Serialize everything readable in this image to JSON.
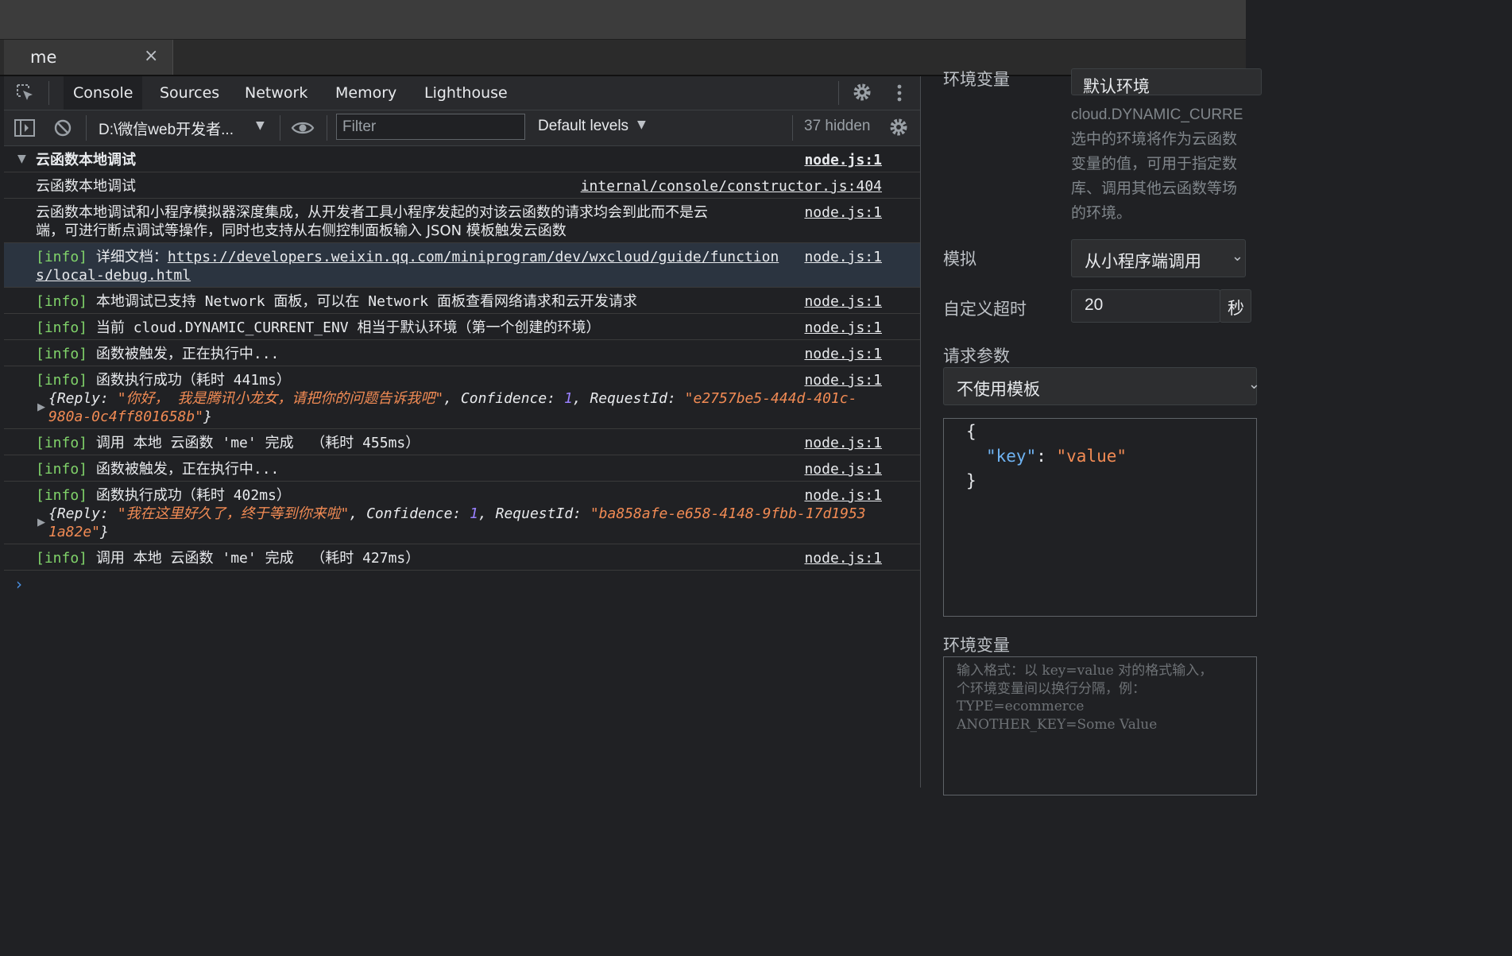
{
  "tab": {
    "title": "me",
    "close": "×"
  },
  "devtools": {
    "tabs": [
      "Console",
      "Sources",
      "Network",
      "Memory",
      "Lighthouse"
    ],
    "context": "D:\\微信web开发者...",
    "filter_placeholder": "Filter",
    "levels": "Default levels",
    "hidden_count": "37 hidden"
  },
  "console": {
    "group_title": "云函数本地调试",
    "group_src": "node.js:1",
    "rows": [
      {
        "text": "云函数本地调试",
        "src": "internal/console/constructor.js:404"
      },
      {
        "line1": "云函数本地调试和小程序模拟器深度集成，从开发者工具小程序发起的对该云函数的请求均会到此而不是云",
        "line2": "端，可进行断点调试等操作，同时也支持从右侧控制面板输入 JSON 模板触发云函数",
        "src": "node.js:1"
      },
      {
        "tag": "[info]",
        "prefix": "详细文档：",
        "link1": "https://developers.weixin.qq.com/miniprogram/dev/wxcloud/guide/function",
        "link2": "s/local-debug.html",
        "src": "node.js:1"
      },
      {
        "tag": "[info]",
        "text": "本地调试已支持 Network 面板，可以在 Network 面板查看网络请求和云开发请求",
        "src": "node.js:1"
      },
      {
        "tag": "[info]",
        "text": "当前 cloud.DYNAMIC_CURRENT_ENV 相当于默认环境（第一个创建的环境）",
        "src": "node.js:1"
      },
      {
        "tag": "[info]",
        "text": "函数被触发，正在执行中...",
        "src": "node.js:1"
      },
      {
        "tag": "[info]",
        "text": "函数执行成功（耗时 441ms）",
        "src": "node.js:1",
        "obj": {
          "reply_key": "{Reply: ",
          "reply": "\"你好， 我是腾讯小龙女，请把你的问题告诉我吧\"",
          "conf_key": ", Confidence: ",
          "conf": "1",
          "rid_key": ", RequestId: ",
          "rid1": "\"e2757be5-444d-401c-",
          "rid2": "980a-0c4ff801658b\"",
          "end": "}"
        }
      },
      {
        "tag": "[info]",
        "text": "调用 本地 云函数 'me' 完成  （耗时 455ms）",
        "src": "node.js:1"
      },
      {
        "tag": "[info]",
        "text": "函数被触发，正在执行中...",
        "src": "node.js:1"
      },
      {
        "tag": "[info]",
        "text": "函数执行成功（耗时 402ms）",
        "src": "node.js:1",
        "obj": {
          "reply_key": "{Reply: ",
          "reply": "\"我在这里好久了，终于等到你来啦\"",
          "conf_key": ", Confidence: ",
          "conf": "1",
          "rid_key": ", RequestId: ",
          "rid1": "\"ba858afe-e658-4148-9fbb-17d1953",
          "rid2": "1a82e\"",
          "end": "}"
        }
      },
      {
        "tag": "[info]",
        "text": "调用 本地 云函数 'me' 完成  （耗时 427ms）",
        "src": "node.js:1"
      }
    ],
    "prompt": "›"
  },
  "side": {
    "env_label": "环境变量",
    "env_value": "默认环境",
    "env_desc": [
      "cloud.DYNAMIC_CURRE",
      "选中的环境将作为云函数",
      "变量的值，可用于指定数",
      "库、调用其他云函数等场",
      "的环境。"
    ],
    "mock_label": "模拟",
    "mock_value": "从小程序端调用",
    "timeout_label": "自定义超时",
    "timeout_value": "20",
    "timeout_unit": "秒",
    "params_label": "请求参数",
    "params_value": "不使用模板",
    "json_open": "{",
    "json_key": "\"key\"",
    "json_colon": ": ",
    "json_val": "\"value\"",
    "json_close": "}",
    "envvars_label": "环境变量",
    "envvars_placeholder": [
      "输入格式：以 key=value 对的格式输入，",
      "个环境变量间以换行分隔，例：",
      "TYPE=ecommerce",
      "ANOTHER_KEY=Some Value"
    ]
  }
}
